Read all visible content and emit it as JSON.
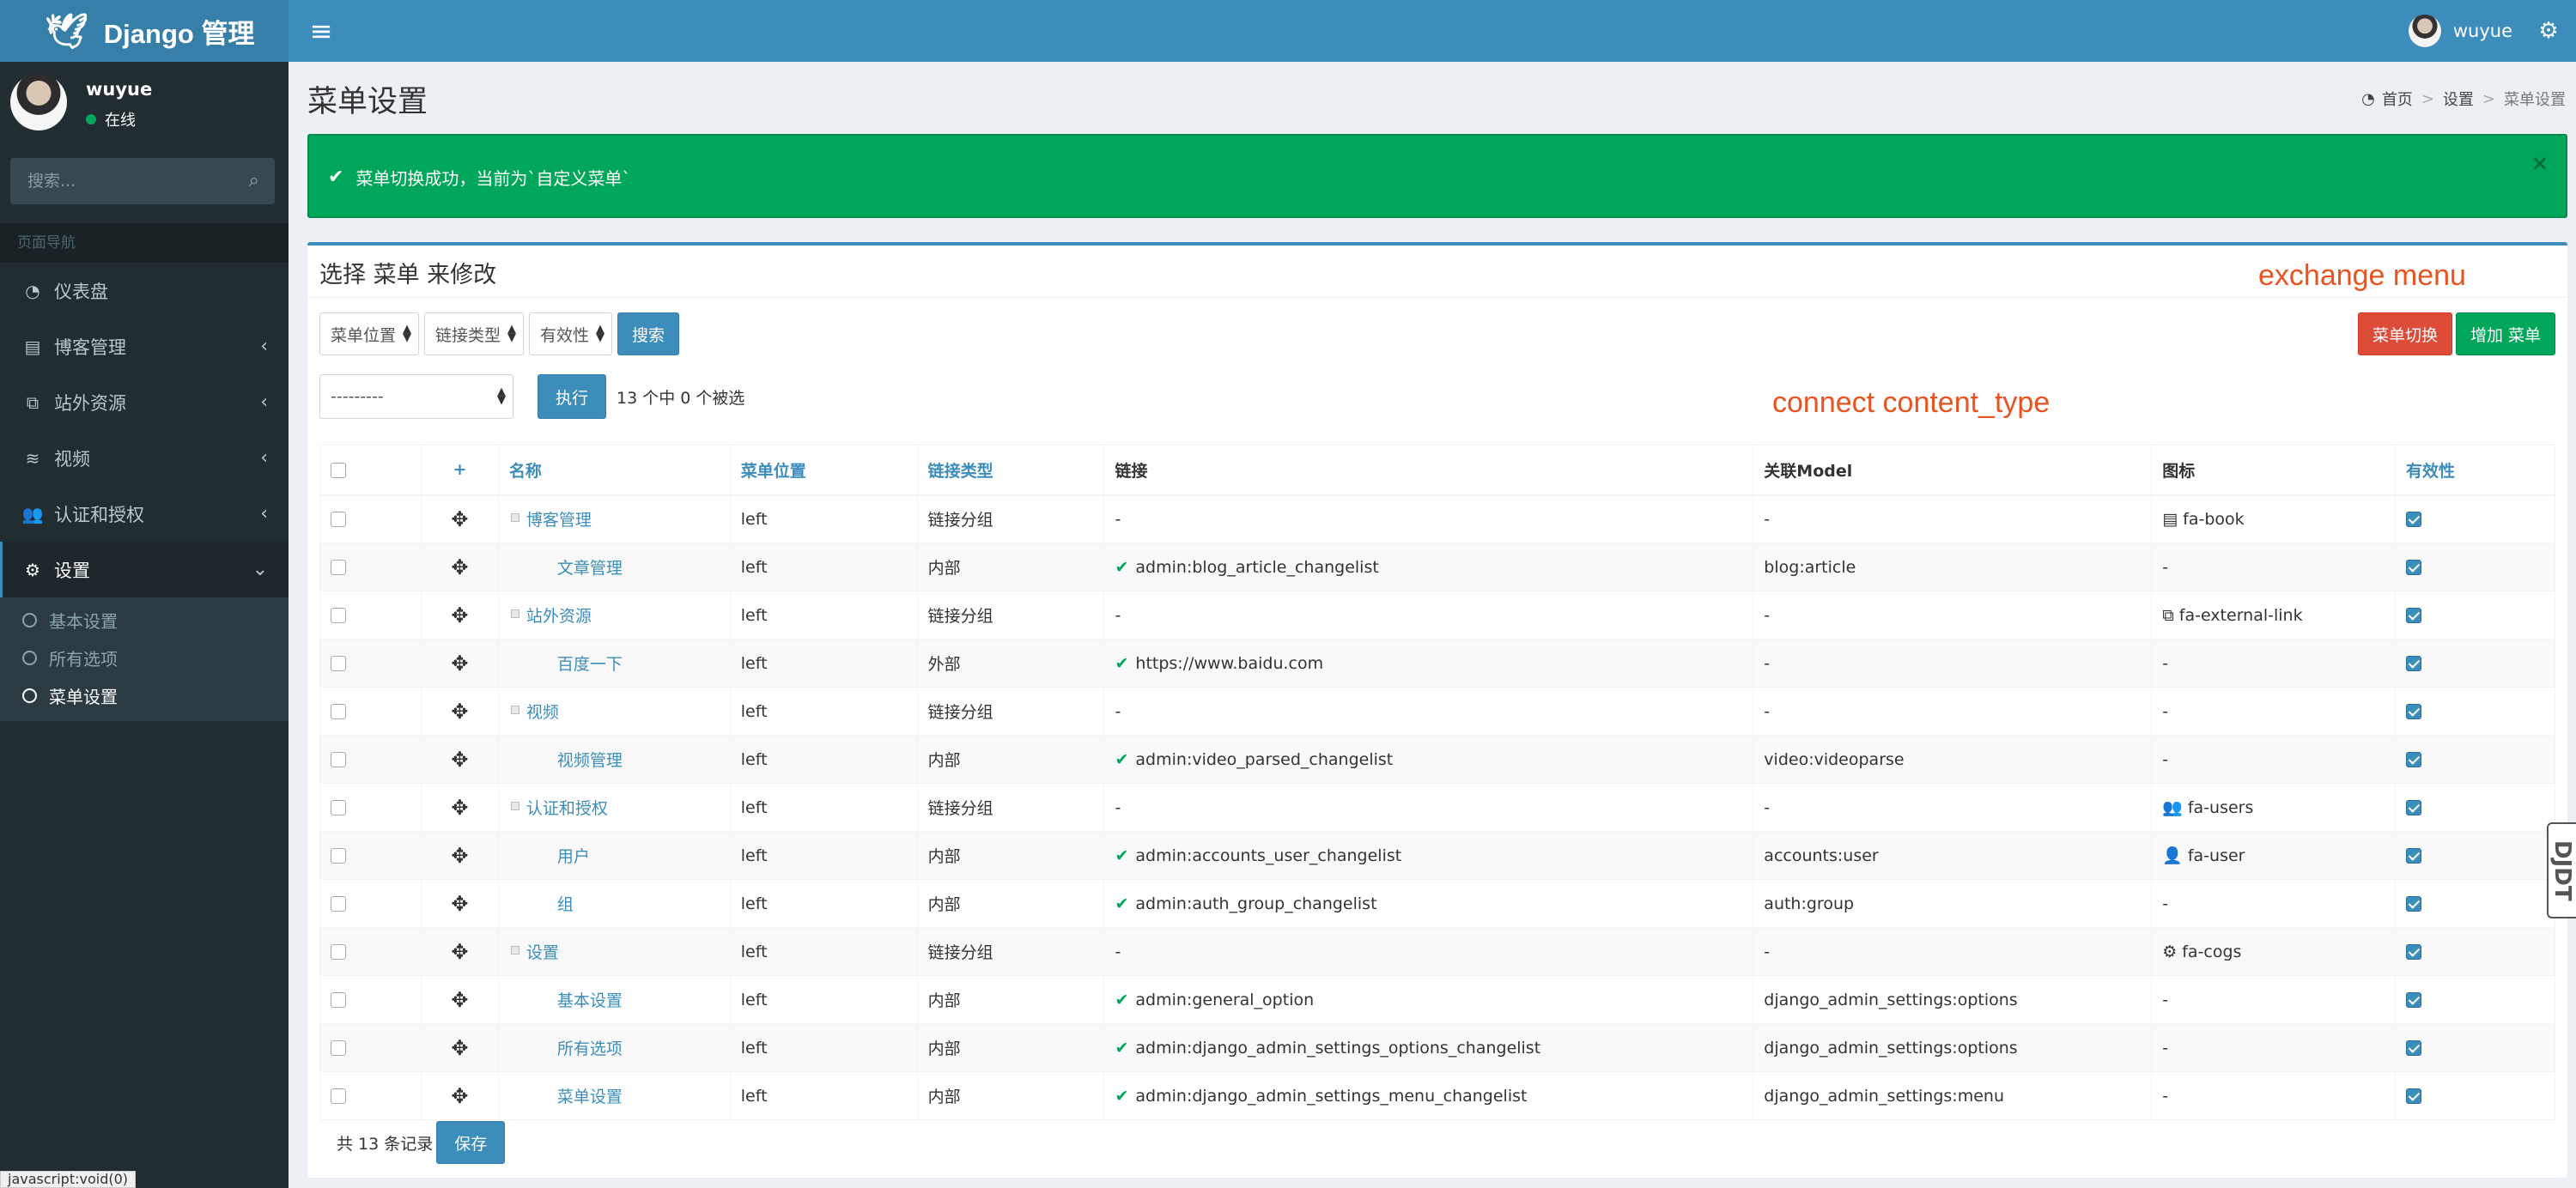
{
  "app": {
    "title": "Django 管理"
  },
  "topbar": {
    "username": "wuyue"
  },
  "sidebar": {
    "username": "wuyue",
    "status": "在线",
    "search_placeholder": "搜索...",
    "nav_header": "页面导航",
    "items": [
      {
        "label": "仪表盘",
        "icon": "dashboard-icon"
      },
      {
        "label": "博客管理",
        "icon": "book-icon"
      },
      {
        "label": "站外资源",
        "icon": "external-link-icon"
      },
      {
        "label": "视频",
        "icon": "database-icon"
      },
      {
        "label": "认证和授权",
        "icon": "users-icon"
      },
      {
        "label": "设置",
        "icon": "cogs-icon"
      }
    ],
    "subitems": [
      {
        "label": "基本设置"
      },
      {
        "label": "所有选项"
      },
      {
        "label": "菜单设置"
      }
    ]
  },
  "status_bar": "javascript:void(0)",
  "page": {
    "title": "菜单设置",
    "breadcrumb": {
      "home": "首页",
      "section": "设置",
      "current": "菜单设置"
    },
    "alert": "菜单切换成功，当前为`自定义菜单`"
  },
  "box": {
    "title": "选择 菜单 来修改",
    "filters": [
      "菜单位置",
      "链接类型",
      "有效性"
    ],
    "search_button": "搜索",
    "switch_button": "菜单切换",
    "add_button": "增加 菜单",
    "action_select": "---------",
    "action_button": "执行",
    "counter": "13 个中 0 个被选",
    "annotation_exchange": "exchange menu",
    "annotation_connect": "connect content_type",
    "footer_count": "共 13 条记录",
    "save_button": "保存"
  },
  "table": {
    "headers": [
      "+",
      "名称",
      "菜单位置",
      "链接类型",
      "链接",
      "关联Model",
      "图标",
      "有效性"
    ],
    "rows": [
      {
        "name": "博客管理",
        "group": true,
        "position": "left",
        "type": "链接分组",
        "link": "-",
        "linked": false,
        "model": "-",
        "icon": "fa-book",
        "icon_glyph": "▤"
      },
      {
        "name": "文章管理",
        "group": false,
        "position": "left",
        "type": "内部",
        "link": "admin:blog_article_changelist",
        "linked": true,
        "model": "blog:article",
        "icon": "-",
        "icon_glyph": ""
      },
      {
        "name": "站外资源",
        "group": true,
        "position": "left",
        "type": "链接分组",
        "link": "-",
        "linked": false,
        "model": "-",
        "icon": "fa-external-link",
        "icon_glyph": "⧉"
      },
      {
        "name": "百度一下",
        "group": false,
        "position": "left",
        "type": "外部",
        "link": "https://www.baidu.com",
        "linked": true,
        "model": "-",
        "icon": "-",
        "icon_glyph": ""
      },
      {
        "name": "视频",
        "group": true,
        "position": "left",
        "type": "链接分组",
        "link": "-",
        "linked": false,
        "model": "-",
        "icon": "-",
        "icon_glyph": ""
      },
      {
        "name": "视频管理",
        "group": false,
        "position": "left",
        "type": "内部",
        "link": "admin:video_parsed_changelist",
        "linked": true,
        "model": "video:videoparse",
        "icon": "-",
        "icon_glyph": ""
      },
      {
        "name": "认证和授权",
        "group": true,
        "position": "left",
        "type": "链接分组",
        "link": "-",
        "linked": false,
        "model": "-",
        "icon": "fa-users",
        "icon_glyph": "👥"
      },
      {
        "name": "用户",
        "group": false,
        "position": "left",
        "type": "内部",
        "link": "admin:accounts_user_changelist",
        "linked": true,
        "model": "accounts:user",
        "icon": "fa-user",
        "icon_glyph": "👤"
      },
      {
        "name": "组",
        "group": false,
        "position": "left",
        "type": "内部",
        "link": "admin:auth_group_changelist",
        "linked": true,
        "model": "auth:group",
        "icon": "-",
        "icon_glyph": ""
      },
      {
        "name": "设置",
        "group": true,
        "position": "left",
        "type": "链接分组",
        "link": "-",
        "linked": false,
        "model": "-",
        "icon": "fa-cogs",
        "icon_glyph": "⚙"
      },
      {
        "name": "基本设置",
        "group": false,
        "position": "left",
        "type": "内部",
        "link": "admin:general_option",
        "linked": true,
        "model": "django_admin_settings:options",
        "icon": "-",
        "icon_glyph": ""
      },
      {
        "name": "所有选项",
        "group": false,
        "position": "left",
        "type": "内部",
        "link": "admin:django_admin_settings_options_changelist",
        "linked": true,
        "model": "django_admin_settings:options",
        "icon": "-",
        "icon_glyph": ""
      },
      {
        "name": "菜单设置",
        "group": false,
        "position": "left",
        "type": "内部",
        "link": "admin:django_admin_settings_menu_changelist",
        "linked": true,
        "model": "django_admin_settings:menu",
        "icon": "-",
        "icon_glyph": ""
      }
    ]
  }
}
